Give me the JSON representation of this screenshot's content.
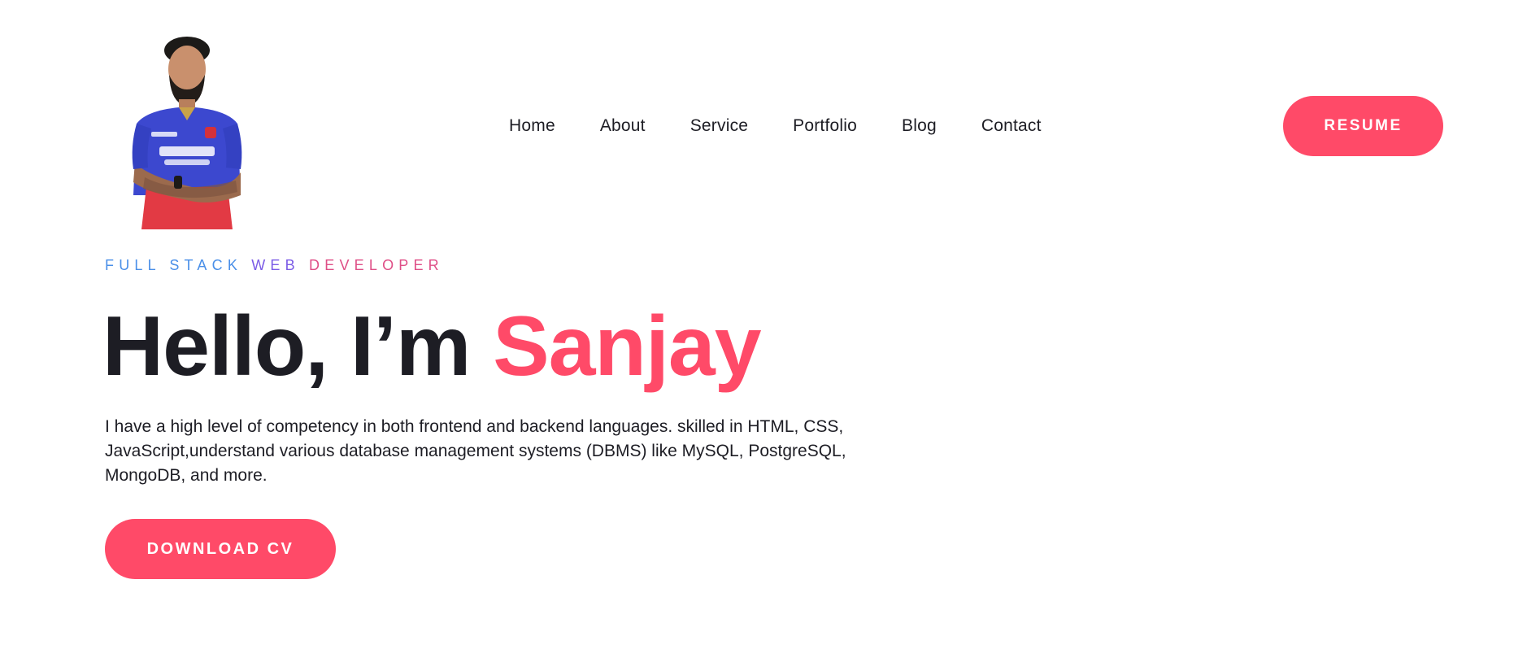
{
  "header": {
    "logo_icon": "profile-photo-icon",
    "nav": [
      {
        "label": "Home"
      },
      {
        "label": "About"
      },
      {
        "label": "Service"
      },
      {
        "label": "Portfolio"
      },
      {
        "label": "Blog"
      },
      {
        "label": "Contact"
      }
    ],
    "resume_label": "RESUME"
  },
  "hero": {
    "subtitle_part1": "FULL STACK ",
    "subtitle_part2": "WEB ",
    "subtitle_part3": "DEVELOPER",
    "headline_prefix": "Hello, I’m ",
    "headline_name": "Sanjay",
    "description": "I have a high level of competency in both frontend and backend languages. skilled in HTML, CSS, JavaScript,understand various database management systems (DBMS) like MySQL, PostgreSQL, MongoDB, and more.",
    "download_label": "DOWNLOAD CV"
  },
  "colors": {
    "accent": "#ff4a68",
    "text": "#1d1d24",
    "gradient_start": "#4a8fe8",
    "gradient_mid": "#7b5be6",
    "gradient_end": "#df4f87"
  }
}
